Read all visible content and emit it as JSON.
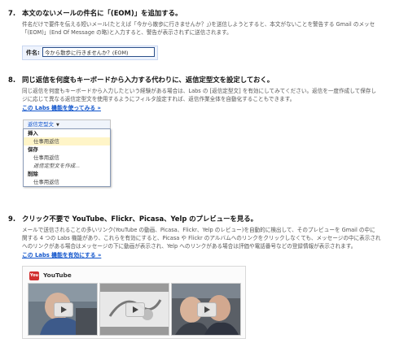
{
  "s7": {
    "num": "7.",
    "title": "本文のないメールの件名に「(EOM)」を追加する。",
    "desc1": "件名だけで要件を伝える短いメール(たとえば「今から散歩に行きませんか？」)を送信しようとすると、本文がないことを警告する Gmail のメッセ",
    "desc2": "「(EOM)」(End Of Message の略)と入力すると、警告が表示されずに送信されます。",
    "subject_label": "件名:",
    "subject_value": "今から散歩に行きませんか？(EOM)"
  },
  "s8": {
    "num": "8.",
    "title": "同じ返信を何度もキーボードから入力する代わりに、返信定型文を設定しておく。",
    "desc1": "同じ返信を何度もキーボードから入力したという経験がある場合は、Labs の [返信定型文] を有効にしてみてください。返信を一度作成して保存し",
    "desc2": "ジに応じて異なる返信定型文を使用するようにフィルタ設定すれば、返信作業全体を自動化することもできます。",
    "link": "この Labs 機能を使ってみる »",
    "menu": {
      "button": "返信定型文",
      "arrow": "▼",
      "insert": "挿入",
      "insert_item": "仕事用返信",
      "save": "保存",
      "save_item": "仕事用返信",
      "new_item": "返信定型文を作成...",
      "delete": "削除",
      "delete_item": "仕事用返信"
    }
  },
  "s9": {
    "num": "9.",
    "title": "クリック不要で YouTube、Flickr、Picasa、Yelp のプレビューを見る。",
    "desc1": "メールで送信されることの多いリンク(YouTube の動画、Picasa、Flickr、Yelp のレビュー)を自動的に検出して、そのプレビューを Gmail の中に",
    "desc2": "関する 4 つの Labs 機能があり、これらを有効にすると、Picasa や Flickr のアルバムへのリンクをクリックしなくても、メッセージの中に表示され",
    "desc3": "へのリンクがある場合はメッセージの下に動画が表示され、Yelp へのリンクがある場合は評価や電話番号などの登録情報が表示されます。",
    "link": "この Labs 機能を有効にする »",
    "preview_title": "YouTube",
    "logo_text": "You"
  }
}
